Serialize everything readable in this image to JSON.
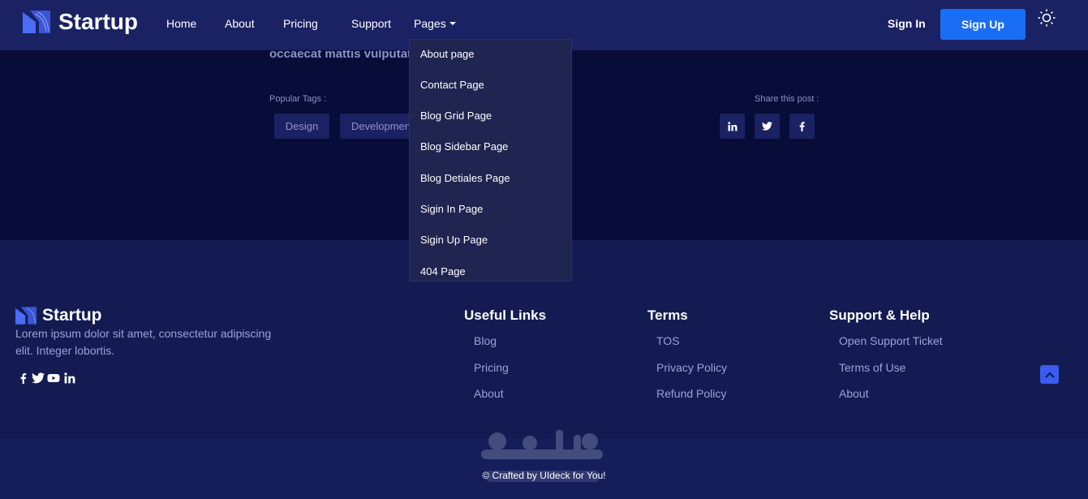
{
  "header": {
    "brand": "Startup",
    "nav": [
      "Home",
      "About",
      "Pricing",
      "Support",
      "Pages"
    ],
    "sign_in": "Sign In",
    "sign_up": "Sign Up",
    "theme_icon": "sun-icon"
  },
  "article": {
    "cut_text": "occaecat mattis vulputate",
    "popular_tags_label": "Popular Tags :",
    "tags": [
      "Design",
      "Development"
    ],
    "share_label": "Share this post :",
    "share_icons": [
      "linkedin-icon",
      "twitter-icon",
      "facebook-icon"
    ]
  },
  "dropdown": {
    "items": [
      "About page",
      "Contact Page",
      "Blog Grid Page",
      "Blog Sidebar Page",
      "Blog Detiales Page",
      "Sigin In Page",
      "Sigin Up Page",
      "404 Page"
    ]
  },
  "footer": {
    "brand": "Startup",
    "description": "Lorem ipsum dolor sit amet, consectetur adipiscing elit. Integer lobortis.",
    "social_icons": [
      "facebook-icon",
      "twitter-icon",
      "youtube-icon",
      "linkedin-icon"
    ],
    "columns": [
      {
        "title": "Useful Links",
        "links": [
          "Blog",
          "Pricing",
          "About"
        ]
      },
      {
        "title": "Terms",
        "links": [
          "TOS",
          "Privacy Policy",
          "Refund Policy"
        ]
      },
      {
        "title": "Support & Help",
        "links": [
          "Open Support Ticket",
          "Terms of Use",
          "About"
        ]
      }
    ],
    "copyright": "© Crafted by UIdeck for You!"
  },
  "colors": {
    "header_bg": "#1a2264",
    "band_bg": "#070c38",
    "footer_bg": "#131b52",
    "accent": "#1a6ef5",
    "muted_text": "#9aa2d6"
  }
}
